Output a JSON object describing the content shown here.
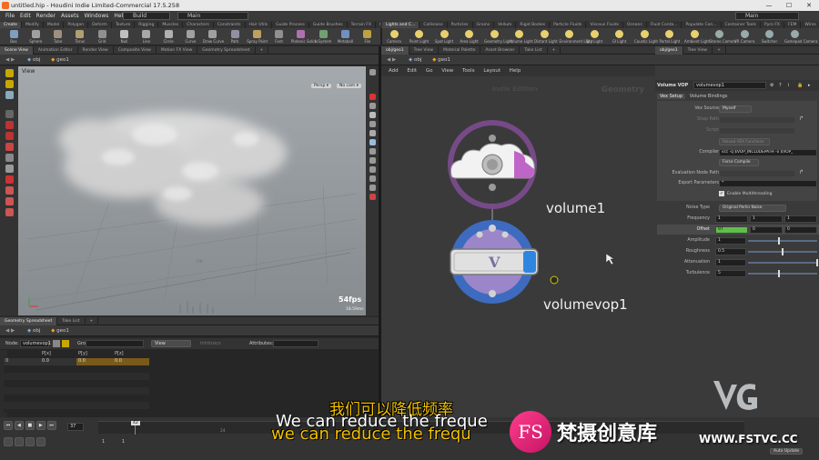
{
  "window": {
    "title": "untitled.hip - Houdini Indie Limited-Commercial 17.5.258",
    "minimize": "—",
    "maximize": "☐",
    "close": "✕"
  },
  "menu": {
    "items": [
      "File",
      "Edit",
      "Render",
      "Assets",
      "Windows",
      "Help"
    ],
    "build_desk": "Build",
    "main_desk": "Main",
    "right_desk": "Main"
  },
  "shelf": {
    "left_tabs": [
      "Create",
      "Modify",
      "Model",
      "Polygon",
      "Deform",
      "Texture",
      "Rigging",
      "Muscles",
      "Characters",
      "Constraints",
      "Hair Utils",
      "Guide Process",
      "Guide Brushes",
      "Terrain FX",
      "Cloud FX",
      "Volume"
    ],
    "left_tools": [
      "Box",
      "Sphere",
      "Tube",
      "Torus",
      "Grid",
      "Null",
      "Line",
      "Circle",
      "Curve",
      "Draw Curve",
      "Path",
      "Spray Paint",
      "Font",
      "Platonic Solids",
      "L-System",
      "Metaball",
      "File"
    ],
    "right_tabs": [
      "Lights and C...",
      "Collisions",
      "Particles",
      "Grains",
      "Vellum",
      "Rigid Bodies",
      "Particle Fluids",
      "Viscous Fluids",
      "Oceans",
      "Fluid Conta...",
      "Populate Con...",
      "Container Tools",
      "Pyro FX",
      "FEM",
      "Wires",
      "Crowds",
      "Drive Simula..."
    ],
    "right_tools": [
      "Camera",
      "Point Light",
      "Spot Light",
      "Area Light",
      "Geometry Light",
      "Volume Light",
      "Distant Light",
      "Environment Light",
      "Sky Light",
      "GI Light",
      "Caustic Light",
      "Portal Light",
      "Ambient Light",
      "Stereo Camera",
      "VR Camera",
      "Switcher",
      "Gamepad Camera"
    ]
  },
  "viewport": {
    "tabs": [
      "Scene View",
      "Animation Editor",
      "Render View",
      "Composite View",
      "Motion FX View",
      "Geometry Spreadsheet"
    ],
    "path_obj": "obj",
    "path_geo": "geo1",
    "view_label": "View",
    "persp": "Persp ▾",
    "cam": "No cam ▾",
    "fps": "54fps",
    "ms": "18.59ms",
    "grid_label": "Uh"
  },
  "spreadsheet": {
    "tabs": [
      "Geometry Spreadsheet",
      "Take List"
    ],
    "path_obj": "obj",
    "path_geo": "geo1",
    "node_label": "Node:",
    "node_value": "volumevop1",
    "group_label": "Group:",
    "view_label": "View",
    "intrinsics_label": "Intrinsics",
    "attributes_label": "Attributes:",
    "columns": [
      "",
      "P[x]",
      "P[y]",
      "P[z]"
    ],
    "rows": [
      [
        "0",
        "0.0",
        "0.0",
        "0.0"
      ]
    ]
  },
  "network": {
    "tabs": [
      "obj/geo1",
      "Tree View",
      "Material Palette",
      "Asset Browser",
      "Take List"
    ],
    "path_obj": "obj",
    "path_geo": "geo1",
    "menu": [
      "Add",
      "Edit",
      "Go",
      "View",
      "Tools",
      "Layout",
      "Help"
    ],
    "watermark_left": "Indie Edition",
    "watermark_right": "Geometry",
    "nodes": [
      {
        "name": "volume1"
      },
      {
        "name": "volumevop1"
      }
    ]
  },
  "params": {
    "tabs": [
      "obj/geo1",
      "Tree View"
    ],
    "node_type": "Volume VOP",
    "node_name": "volumevop1",
    "sub_tabs": [
      "Vex Setup",
      "Volume Bindings"
    ],
    "vex_source_label": "Vex Source",
    "vex_source_value": "Myself",
    "shop_path_label": "Shop Path",
    "script_label": "Script",
    "reload_label": "Reload VEX Functions",
    "compiler_label": "Compiler",
    "compiler_value": "vcc -q $VOP_INCLUDEPATH -o $VOP_",
    "force_compile": "Force Compile",
    "eval_node_label": "Evaluation Node Path",
    "export_label": "Export Parameters",
    "export_value": "*",
    "multithread_label": "Enable Multithreading",
    "noise_type_label": "Noise Type",
    "noise_type_value": "Original Perlin Noise",
    "frequency_label": "Frequency",
    "frequency": [
      "1",
      "1",
      "1"
    ],
    "offset_label": "Offset",
    "offset": [
      "97",
      "0",
      "0"
    ],
    "amplitude_label": "Amplitude",
    "amplitude": "1",
    "amplitude_fill": 0.45,
    "roughness_label": "Roughness",
    "roughness": "0.5",
    "roughness_fill": 0.5,
    "attenuation_label": "Attenuation",
    "attenuation": "1",
    "attenuation_fill": 1.0,
    "turbulence_label": "Turbulence",
    "turbulence": "5",
    "turbulence_fill": 0.45
  },
  "timeline": {
    "current_frame": "37",
    "playhead_frame": "42",
    "ticks": [
      "",
      "",
      "24",
      "",
      "48"
    ],
    "start": "1",
    "end": "1",
    "auto_update": "Auto Update"
  },
  "subtitles": {
    "chinese": "我们可以降低频率",
    "english_white": "We can reduce the freque",
    "english_yellow": "we can reduce the frequ"
  },
  "branding": {
    "fs_logo": "FS",
    "cn_name": "梵摄创意库",
    "url": "WWW.FSTVC.CC",
    "vg_logo": "VG"
  },
  "colors": {
    "accent_orange": "#f0a020",
    "node_purple": "#7a4b8c",
    "node_blue": "#3d6bbf",
    "offset_green": "#5fbf4a",
    "subtitle_yellow": "#f2c200",
    "fs_pink": "#ff2a7f"
  }
}
